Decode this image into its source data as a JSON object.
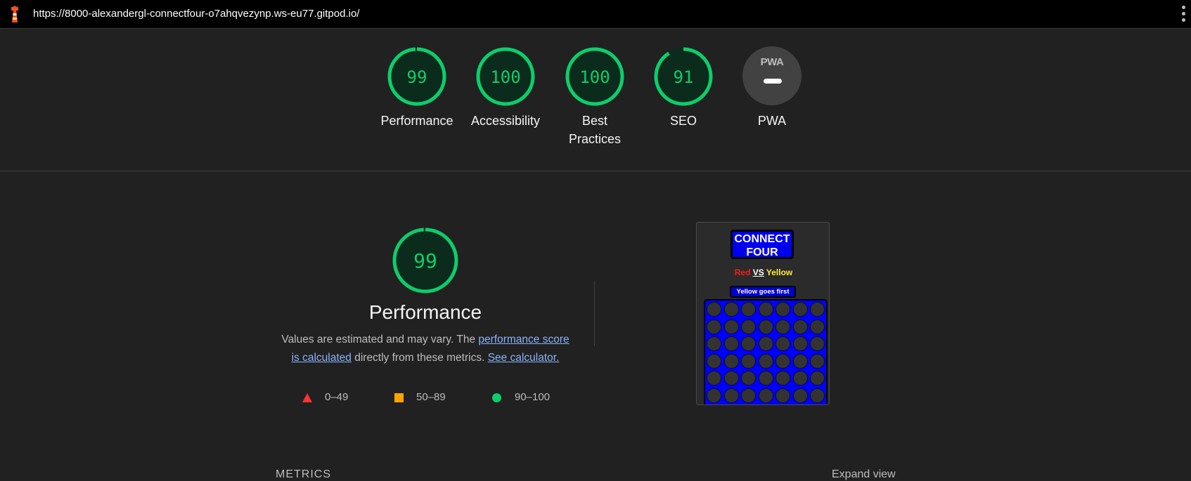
{
  "topbar": {
    "url": "https://8000-alexandergl-connectfour-o7ahqvezynp.ws-eu77.gitpod.io/",
    "logo_icon": "lighthouse-icon",
    "menu_icon": "kebab-menu-icon"
  },
  "scores": [
    {
      "label": "Performance",
      "value": "99",
      "fraction": 0.99
    },
    {
      "label": "Accessibility",
      "value": "100",
      "fraction": 1.0
    },
    {
      "label": "Best\nPractices",
      "value": "100",
      "fraction": 1.0
    },
    {
      "label": "SEO",
      "value": "91",
      "fraction": 0.91
    }
  ],
  "pwa": {
    "badge": "PWA",
    "label": "PWA"
  },
  "performance_section": {
    "score": "99",
    "title": "Performance",
    "desc_prefix": "Values are estimated and may vary. The ",
    "desc_link1": "performance score is calculated",
    "desc_middle": " directly from these metrics. ",
    "desc_link2": "See calculator."
  },
  "legend": [
    {
      "range": "0–49",
      "shape": "triangle",
      "color": "#ff3333"
    },
    {
      "range": "50–89",
      "shape": "square",
      "color": "#ffa400"
    },
    {
      "range": "90–100",
      "shape": "circle",
      "color": "#0cce6b"
    }
  ],
  "thumbnail": {
    "title": "CONNECT FOUR",
    "vs_red": "Red",
    "vs_word": "VS",
    "vs_yellow": "Yellow",
    "turn": "Yellow goes first"
  },
  "footer": {
    "metrics": "METRICS",
    "expand": "Expand view"
  },
  "colors": {
    "good": "#0cce6b",
    "good_bg": "#0b2b1c",
    "background": "#212121"
  }
}
